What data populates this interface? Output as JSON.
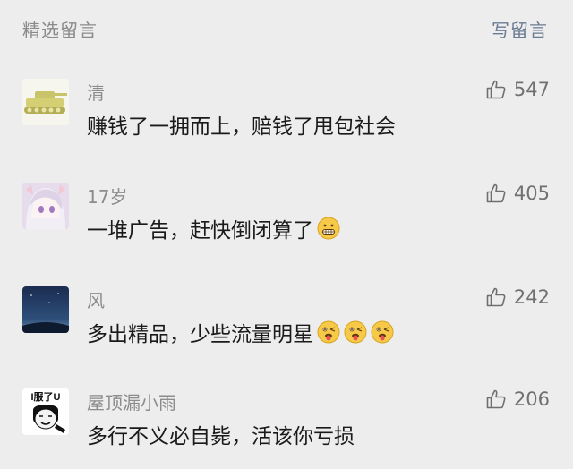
{
  "header": {
    "title": "精选留言",
    "write_label": "写留言"
  },
  "comments": [
    {
      "nickname": "清",
      "text": "赚钱了一拥而上，赔钱了甩包社会",
      "likes": "547",
      "avatar_icon": "tank-avatar",
      "emojis": []
    },
    {
      "nickname": "17岁",
      "text": "一堆广告，赶快倒闭算了",
      "likes": "405",
      "avatar_icon": "anime-girl-avatar",
      "emojis": [
        "grimace-emoji"
      ]
    },
    {
      "nickname": "风",
      "text": "多出精品，少些流量明星",
      "likes": "242",
      "avatar_icon": "night-sky-avatar",
      "emojis": [
        "wink-tongue-emoji",
        "wink-tongue-emoji",
        "wink-tongue-emoji"
      ]
    },
    {
      "nickname": "屋顶漏小雨",
      "text": "多行不义必自毙，活该你亏损",
      "likes": "206",
      "avatar_icon": "meme-face-avatar",
      "avatar_text": "I服了U",
      "emojis": []
    }
  ],
  "colors": {
    "background": "#ededed",
    "nickname": "#8c8c8c",
    "text": "#1a1a1a",
    "link": "#6b7b93"
  }
}
